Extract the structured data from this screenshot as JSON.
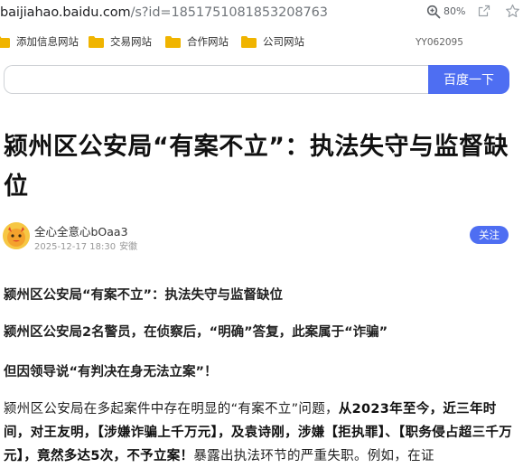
{
  "browser": {
    "url_host": "baijiahao.baidu.com",
    "url_path": "/s?id=1851751081853208763",
    "zoom": "80%"
  },
  "bookmarks": {
    "items": [
      "添加信息网站",
      "交易网站",
      "合作网站",
      "公司网站"
    ],
    "profile_id": "YY062095"
  },
  "search": {
    "value": "",
    "button_label": "百度一下"
  },
  "article": {
    "title": "颍州区公安局“有案不立”：执法失守与监督缺位",
    "author": "全心全意心bOaa3",
    "date": "2025-12-17 18:30",
    "location": "安徽",
    "follow_label": "关注",
    "paragraph1": "颍州区公安局“有案不立”：执法失守与监督缺位",
    "paragraph2": "颍州区公安局2名警员，在侦察后，“明确”答复，此案属于“诈骗”",
    "paragraph3": "但因领导说“有判决在身无法立案”！",
    "body": {
      "part1": "颍州区公安局在多起案件中存在明显的“有案不立”问题，",
      "part2": "从2023年至今，近三年时间，对王友明，【涉嫌诈骗上千万元】，及袁诗刚，涉嫌【拒执罪】、【职务侵占超三千万元】，竟然多达5次，不予立案！",
      "part3": "暴露出执法环节的严重失职。例如，在证"
    }
  },
  "colors": {
    "accent": "#4e6ef2",
    "folder": "#f0b400"
  }
}
